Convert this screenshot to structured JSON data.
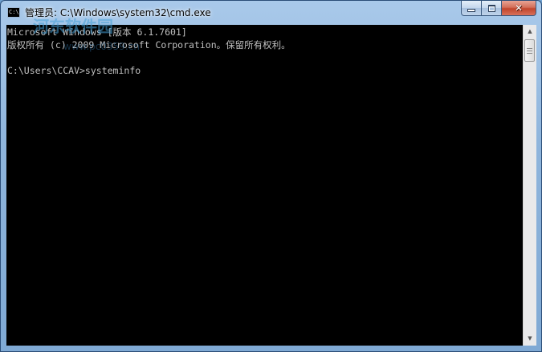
{
  "window": {
    "title": "管理员: C:\\Windows\\system32\\cmd.exe",
    "icon": "cmd-icon",
    "icon_text": "C:\\"
  },
  "caption": {
    "minimize_icon": "minimize-icon",
    "maximize_icon": "maximize-icon",
    "close_icon": "close-icon",
    "close_glyph": "✕"
  },
  "console": {
    "lines": [
      "Microsoft Windows [版本 6.1.7601]",
      "版权所有 (c) 2009 Microsoft Corporation。保留所有权利。",
      "",
      "C:\\Users\\CCAV>systeminfo"
    ],
    "text_color": "#c0c0c0",
    "background_color": "#000000"
  },
  "scrollbar": {
    "up_arrow": "▲",
    "down_arrow": "▼",
    "position_fraction": 0
  },
  "watermark": {
    "text": "河东软件园",
    "url": "www.pc0359.cn"
  }
}
